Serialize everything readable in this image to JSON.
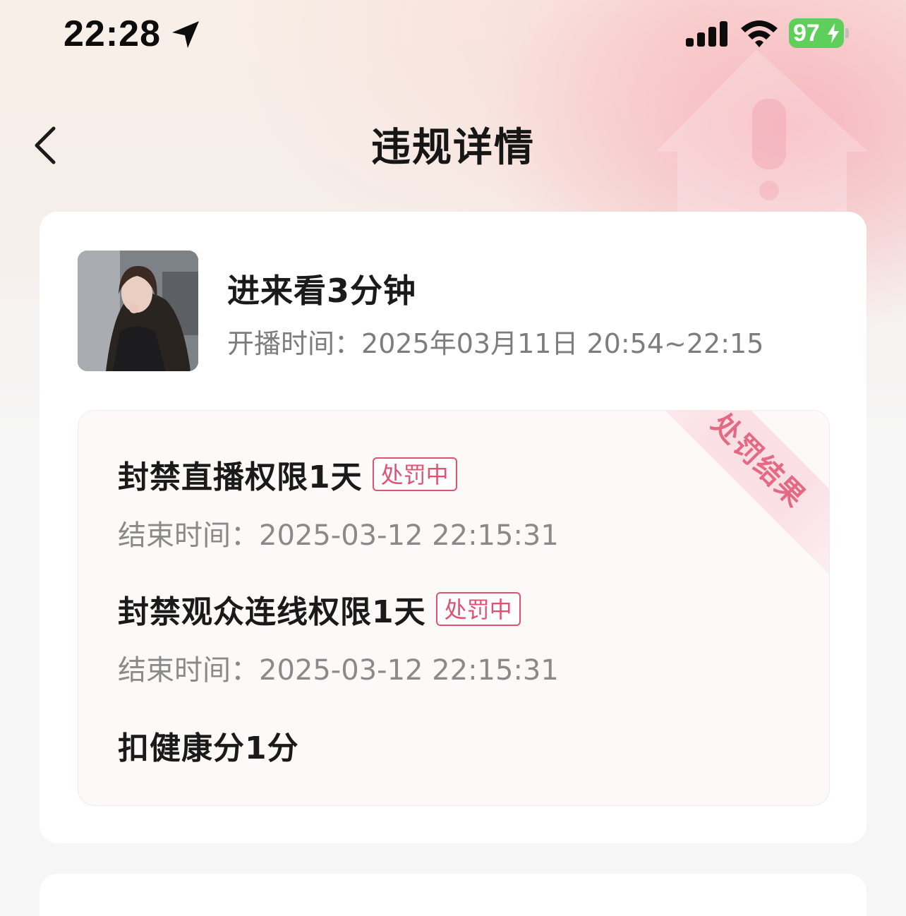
{
  "status_bar": {
    "time": "22:28",
    "battery": "97"
  },
  "header": {
    "title": "违规详情"
  },
  "stream": {
    "title": "进来看3分钟",
    "time_label": "开播时间：",
    "time_value": "2025年03月11日 20:54~22:15"
  },
  "penalty": {
    "ribbon": "处罚结果",
    "items": [
      {
        "title": "封禁直播权限1天",
        "badge": "处罚中",
        "end_label": "结束时间：",
        "end_value": "2025-03-12 22:15:31"
      },
      {
        "title": "封禁观众连线权限1天",
        "badge": "处罚中",
        "end_label": "结束时间：",
        "end_value": "2025-03-12 22:15:31"
      },
      {
        "title": "扣健康分1分"
      }
    ]
  },
  "colors": {
    "accent": "#e05272",
    "battery": "#5fcf5c"
  }
}
